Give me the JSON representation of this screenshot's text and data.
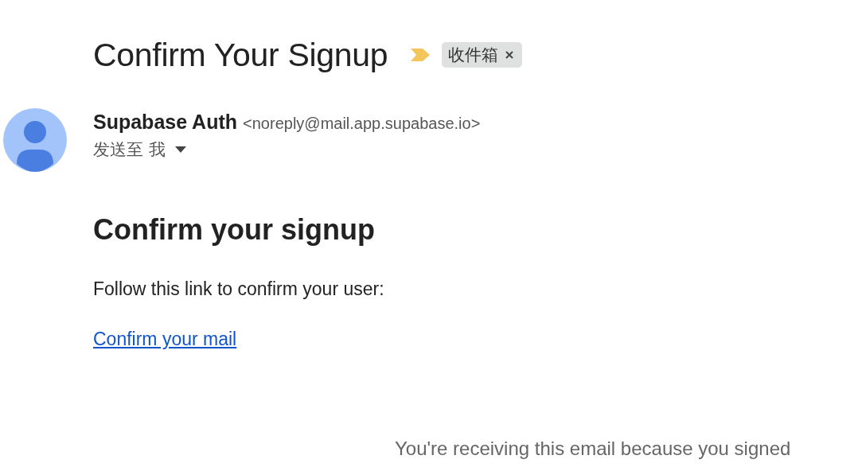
{
  "subject": "Confirm Your Signup",
  "importance_marker": true,
  "label": {
    "text": "收件箱",
    "removable": true
  },
  "sender": {
    "name": "Supabase Auth",
    "address": "<noreply@mail.app.supabase.io>",
    "recipient": "发送至 我"
  },
  "body": {
    "heading": "Confirm your signup",
    "paragraph": "Follow this link to confirm your user:",
    "link": "Confirm your mail"
  },
  "footer": "You're receiving this email because you signed"
}
